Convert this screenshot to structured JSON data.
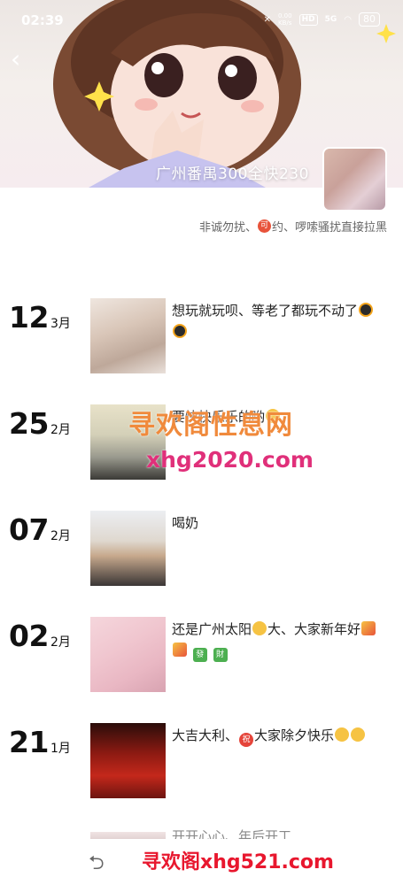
{
  "status_bar": {
    "time": "02:39",
    "net_speed": "0.00\nKB/s",
    "hd": "HD",
    "signal": "5G",
    "battery": "80"
  },
  "header": {
    "back_icon": "chevron-left-icon",
    "cover_title": "广州番禺300全快230",
    "signature_before": "非诚勿扰、",
    "signature_badge": "可",
    "signature_after": "约、啰嗦骚扰直接拉黑"
  },
  "posts": [
    {
      "day": "12",
      "month": "3月",
      "text": "想玩就玩呗、等老了都玩不动了",
      "emoji": "qq-penguin"
    },
    {
      "day": "25",
      "month": "2月",
      "text": "要快快乐乐的哟",
      "emoji": "smile"
    },
    {
      "day": "07",
      "month": "2月",
      "text": "喝奶"
    },
    {
      "day": "02",
      "month": "2月",
      "text": "还是广州太阳",
      "text_after": "大、大家新年好",
      "fa1": "發",
      "fa2": "財"
    },
    {
      "day": "21",
      "month": "1月",
      "text": "大吉大利、",
      "badge": "祝",
      "text_after": "大家除夕快乐"
    }
  ],
  "peek": {
    "text": "开开心心、年后开工"
  },
  "watermark": {
    "cn": "寻欢阁性息网",
    "url": "xhg2020.com"
  },
  "footer": {
    "back_nav_glyph": "⮌",
    "watermark": "寻欢阁xhg521.com"
  }
}
